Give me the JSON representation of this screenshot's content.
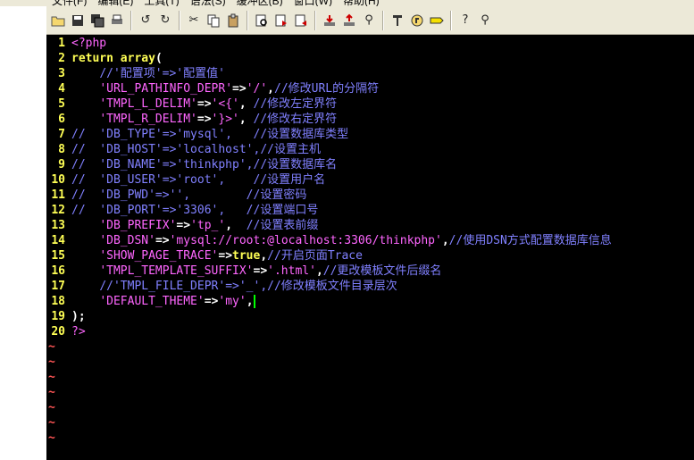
{
  "menu": {
    "items": [
      "文件(F)",
      "编辑(E)",
      "工具(T)",
      "语法(S)",
      "缓冲区(B)",
      "窗口(W)",
      "帮助(H)"
    ]
  },
  "toolbar": {
    "buttons": [
      "open",
      "save",
      "save-all",
      "print",
      "undo",
      "redo",
      "cut",
      "copy",
      "paste",
      "find",
      "find-next",
      "find-prev",
      "load-session",
      "save-session",
      "run-script",
      "make",
      "shell",
      "tags",
      "help",
      "find-help"
    ]
  },
  "colors": {
    "background": "#000000",
    "line_number": "#ffff55",
    "tilde": "#ff5555",
    "keyword": "#ffff55",
    "string": "#ff66ff",
    "comment": "#8080ff",
    "cursor": "#00ff00"
  },
  "editor": {
    "lines": [
      {
        "n": "1",
        "parts": [
          [
            "php",
            "<?php"
          ]
        ]
      },
      {
        "n": "2",
        "parts": [
          [
            "kw",
            "return "
          ],
          [
            "kw",
            "array"
          ],
          [
            "op",
            "("
          ]
        ]
      },
      {
        "n": "3",
        "parts": [
          [
            "plain",
            "    "
          ],
          [
            "com",
            "//'配置项'=>'配置值'"
          ]
        ]
      },
      {
        "n": "4",
        "parts": [
          [
            "plain",
            "    "
          ],
          [
            "str",
            "'URL_PATHINFO_DEPR'"
          ],
          [
            "op",
            "=>"
          ],
          [
            "str",
            "'/'"
          ],
          [
            "op",
            ","
          ],
          [
            "com",
            "//修改URL的分隔符"
          ]
        ]
      },
      {
        "n": "5",
        "parts": [
          [
            "plain",
            "    "
          ],
          [
            "str",
            "'TMPL_L_DELIM'"
          ],
          [
            "op",
            "=>"
          ],
          [
            "str",
            "'<{'"
          ],
          [
            "op",
            ", "
          ],
          [
            "com",
            "//修改左定界符"
          ]
        ]
      },
      {
        "n": "6",
        "parts": [
          [
            "plain",
            "    "
          ],
          [
            "str",
            "'TMPL_R_DELIM'"
          ],
          [
            "op",
            "=>"
          ],
          [
            "str",
            "'}>'"
          ],
          [
            "op",
            ", "
          ],
          [
            "com",
            "//修改右定界符"
          ]
        ]
      },
      {
        "n": "7",
        "parts": [
          [
            "com",
            "//  'DB_TYPE'=>'mysql',   //设置数据库类型"
          ]
        ]
      },
      {
        "n": "8",
        "parts": [
          [
            "com",
            "//  'DB_HOST'=>'localhost',//设置主机"
          ]
        ]
      },
      {
        "n": "9",
        "parts": [
          [
            "com",
            "//  'DB_NAME'=>'thinkphp',//设置数据库名"
          ]
        ]
      },
      {
        "n": "10",
        "parts": [
          [
            "com",
            "//  'DB_USER'=>'root',    //设置用户名"
          ]
        ]
      },
      {
        "n": "11",
        "parts": [
          [
            "com",
            "//  'DB_PWD'=>'',        //设置密码"
          ]
        ]
      },
      {
        "n": "12",
        "parts": [
          [
            "com",
            "//  'DB_PORT'=>'3306',   //设置端口号"
          ]
        ]
      },
      {
        "n": "13",
        "parts": [
          [
            "plain",
            "    "
          ],
          [
            "str",
            "'DB_PREFIX'"
          ],
          [
            "op",
            "=>"
          ],
          [
            "str",
            "'tp_'"
          ],
          [
            "op",
            ",  "
          ],
          [
            "com",
            "//设置表前缀"
          ]
        ]
      },
      {
        "n": "14",
        "parts": [
          [
            "plain",
            "    "
          ],
          [
            "str",
            "'DB_DSN'"
          ],
          [
            "op",
            "=>"
          ],
          [
            "str",
            "'mysql://root:@localhost:3306/thinkphp'"
          ],
          [
            "op",
            ","
          ],
          [
            "com",
            "//使用DSN方式配置数据库信息"
          ]
        ]
      },
      {
        "n": "15",
        "parts": [
          [
            "plain",
            "    "
          ],
          [
            "str",
            "'SHOW_PAGE_TRACE'"
          ],
          [
            "op",
            "=>"
          ],
          [
            "kw",
            "true"
          ],
          [
            "op",
            ","
          ],
          [
            "com",
            "//开启页面Trace"
          ]
        ]
      },
      {
        "n": "16",
        "parts": [
          [
            "plain",
            "    "
          ],
          [
            "str",
            "'TMPL_TEMPLATE_SUFFIX'"
          ],
          [
            "op",
            "=>"
          ],
          [
            "str",
            "'.html'"
          ],
          [
            "op",
            ","
          ],
          [
            "com",
            "//更改模板文件后缀名"
          ]
        ]
      },
      {
        "n": "17",
        "parts": [
          [
            "plain",
            "    "
          ],
          [
            "com",
            "//'TMPL_FILE_DEPR'=>'_',//修改模板文件目录层次"
          ]
        ]
      },
      {
        "n": "18",
        "parts": [
          [
            "plain",
            "    "
          ],
          [
            "str",
            "'DEFAULT_THEME'"
          ],
          [
            "op",
            "=>"
          ],
          [
            "str",
            "'my'"
          ],
          [
            "op",
            ","
          ],
          [
            "cursor",
            ""
          ]
        ]
      },
      {
        "n": "19",
        "parts": [
          [
            "op",
            ");"
          ]
        ]
      },
      {
        "n": "20",
        "parts": [
          [
            "php",
            "?>"
          ]
        ]
      }
    ],
    "tilde": "~",
    "tilde_count": 7
  }
}
